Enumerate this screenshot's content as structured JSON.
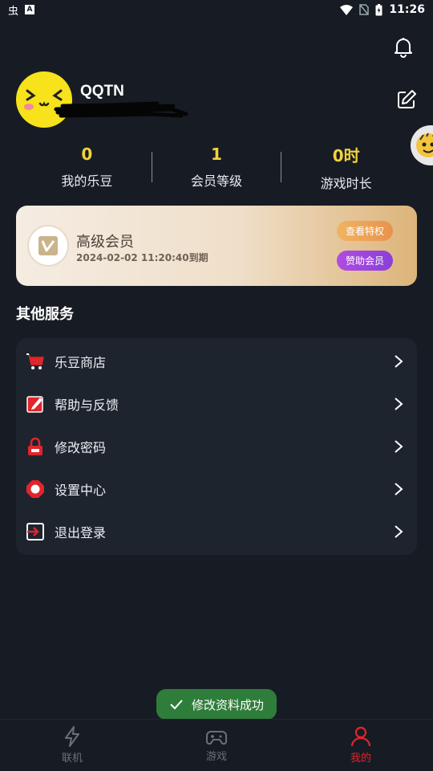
{
  "status_bar": {
    "time": "11:26",
    "left_glyph": "虫",
    "a_badge": "A"
  },
  "profile": {
    "username": "QQTN"
  },
  "stats": [
    {
      "value": "0",
      "label": "我的乐豆"
    },
    {
      "value": "1",
      "label": "会员等级"
    },
    {
      "value": "0时",
      "label": "游戏时长"
    }
  ],
  "vip": {
    "title": "高级会员",
    "expiry": "2024-02-02 11:20:40到期",
    "benefit_button": "查看特权",
    "sponsor_button": "赞助会员",
    "colors": {
      "benefit": "#eea458",
      "sponsor": "#9c45dc"
    }
  },
  "section_title": "其他服务",
  "menu": [
    {
      "label": "乐豆商店",
      "icon": "cart-icon"
    },
    {
      "label": "帮助与反馈",
      "icon": "feedback-icon"
    },
    {
      "label": "修改密码",
      "icon": "lock-icon"
    },
    {
      "label": "设置中心",
      "icon": "settings-icon"
    },
    {
      "label": "退出登录",
      "icon": "logout-icon"
    }
  ],
  "toast": {
    "message": "修改资料成功"
  },
  "nav": [
    {
      "label": "联机",
      "icon": "lightning-icon"
    },
    {
      "label": "游戏",
      "icon": "gamepad-icon"
    },
    {
      "label": "我的",
      "icon": "user-icon",
      "active": true
    }
  ],
  "colors": {
    "accent": "#e0252b",
    "stat": "#f2d23c",
    "background": "#171c24",
    "toast": "#2f7d3a"
  }
}
